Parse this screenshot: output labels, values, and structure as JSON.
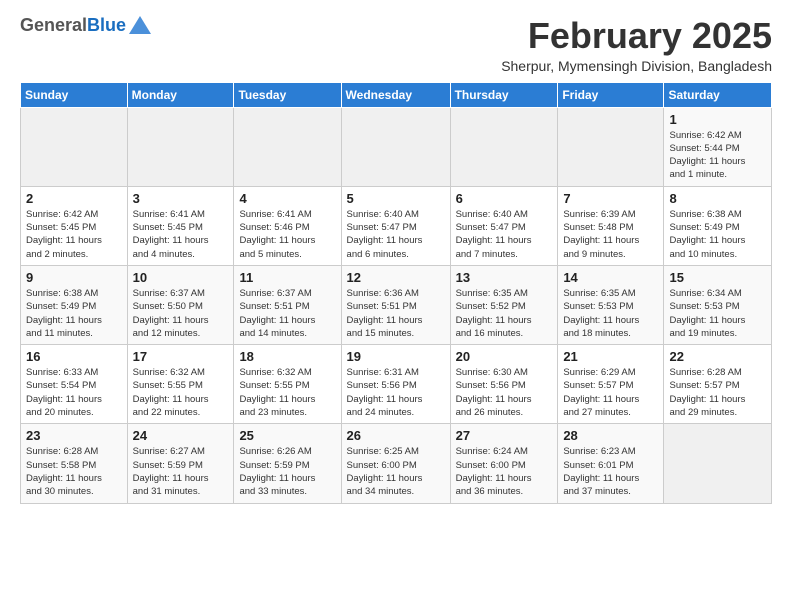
{
  "logo": {
    "general": "General",
    "blue": "Blue"
  },
  "title": {
    "month_year": "February 2025",
    "location": "Sherpur, Mymensingh Division, Bangladesh"
  },
  "weekdays": [
    "Sunday",
    "Monday",
    "Tuesday",
    "Wednesday",
    "Thursday",
    "Friday",
    "Saturday"
  ],
  "weeks": [
    [
      {
        "day": "",
        "info": ""
      },
      {
        "day": "",
        "info": ""
      },
      {
        "day": "",
        "info": ""
      },
      {
        "day": "",
        "info": ""
      },
      {
        "day": "",
        "info": ""
      },
      {
        "day": "",
        "info": ""
      },
      {
        "day": "1",
        "info": "Sunrise: 6:42 AM\nSunset: 5:44 PM\nDaylight: 11 hours\nand 1 minute."
      }
    ],
    [
      {
        "day": "2",
        "info": "Sunrise: 6:42 AM\nSunset: 5:45 PM\nDaylight: 11 hours\nand 2 minutes."
      },
      {
        "day": "3",
        "info": "Sunrise: 6:41 AM\nSunset: 5:45 PM\nDaylight: 11 hours\nand 4 minutes."
      },
      {
        "day": "4",
        "info": "Sunrise: 6:41 AM\nSunset: 5:46 PM\nDaylight: 11 hours\nand 5 minutes."
      },
      {
        "day": "5",
        "info": "Sunrise: 6:40 AM\nSunset: 5:47 PM\nDaylight: 11 hours\nand 6 minutes."
      },
      {
        "day": "6",
        "info": "Sunrise: 6:40 AM\nSunset: 5:47 PM\nDaylight: 11 hours\nand 7 minutes."
      },
      {
        "day": "7",
        "info": "Sunrise: 6:39 AM\nSunset: 5:48 PM\nDaylight: 11 hours\nand 9 minutes."
      },
      {
        "day": "8",
        "info": "Sunrise: 6:38 AM\nSunset: 5:49 PM\nDaylight: 11 hours\nand 10 minutes."
      }
    ],
    [
      {
        "day": "9",
        "info": "Sunrise: 6:38 AM\nSunset: 5:49 PM\nDaylight: 11 hours\nand 11 minutes."
      },
      {
        "day": "10",
        "info": "Sunrise: 6:37 AM\nSunset: 5:50 PM\nDaylight: 11 hours\nand 12 minutes."
      },
      {
        "day": "11",
        "info": "Sunrise: 6:37 AM\nSunset: 5:51 PM\nDaylight: 11 hours\nand 14 minutes."
      },
      {
        "day": "12",
        "info": "Sunrise: 6:36 AM\nSunset: 5:51 PM\nDaylight: 11 hours\nand 15 minutes."
      },
      {
        "day": "13",
        "info": "Sunrise: 6:35 AM\nSunset: 5:52 PM\nDaylight: 11 hours\nand 16 minutes."
      },
      {
        "day": "14",
        "info": "Sunrise: 6:35 AM\nSunset: 5:53 PM\nDaylight: 11 hours\nand 18 minutes."
      },
      {
        "day": "15",
        "info": "Sunrise: 6:34 AM\nSunset: 5:53 PM\nDaylight: 11 hours\nand 19 minutes."
      }
    ],
    [
      {
        "day": "16",
        "info": "Sunrise: 6:33 AM\nSunset: 5:54 PM\nDaylight: 11 hours\nand 20 minutes."
      },
      {
        "day": "17",
        "info": "Sunrise: 6:32 AM\nSunset: 5:55 PM\nDaylight: 11 hours\nand 22 minutes."
      },
      {
        "day": "18",
        "info": "Sunrise: 6:32 AM\nSunset: 5:55 PM\nDaylight: 11 hours\nand 23 minutes."
      },
      {
        "day": "19",
        "info": "Sunrise: 6:31 AM\nSunset: 5:56 PM\nDaylight: 11 hours\nand 24 minutes."
      },
      {
        "day": "20",
        "info": "Sunrise: 6:30 AM\nSunset: 5:56 PM\nDaylight: 11 hours\nand 26 minutes."
      },
      {
        "day": "21",
        "info": "Sunrise: 6:29 AM\nSunset: 5:57 PM\nDaylight: 11 hours\nand 27 minutes."
      },
      {
        "day": "22",
        "info": "Sunrise: 6:28 AM\nSunset: 5:57 PM\nDaylight: 11 hours\nand 29 minutes."
      }
    ],
    [
      {
        "day": "23",
        "info": "Sunrise: 6:28 AM\nSunset: 5:58 PM\nDaylight: 11 hours\nand 30 minutes."
      },
      {
        "day": "24",
        "info": "Sunrise: 6:27 AM\nSunset: 5:59 PM\nDaylight: 11 hours\nand 31 minutes."
      },
      {
        "day": "25",
        "info": "Sunrise: 6:26 AM\nSunset: 5:59 PM\nDaylight: 11 hours\nand 33 minutes."
      },
      {
        "day": "26",
        "info": "Sunrise: 6:25 AM\nSunset: 6:00 PM\nDaylight: 11 hours\nand 34 minutes."
      },
      {
        "day": "27",
        "info": "Sunrise: 6:24 AM\nSunset: 6:00 PM\nDaylight: 11 hours\nand 36 minutes."
      },
      {
        "day": "28",
        "info": "Sunrise: 6:23 AM\nSunset: 6:01 PM\nDaylight: 11 hours\nand 37 minutes."
      },
      {
        "day": "",
        "info": ""
      }
    ]
  ]
}
